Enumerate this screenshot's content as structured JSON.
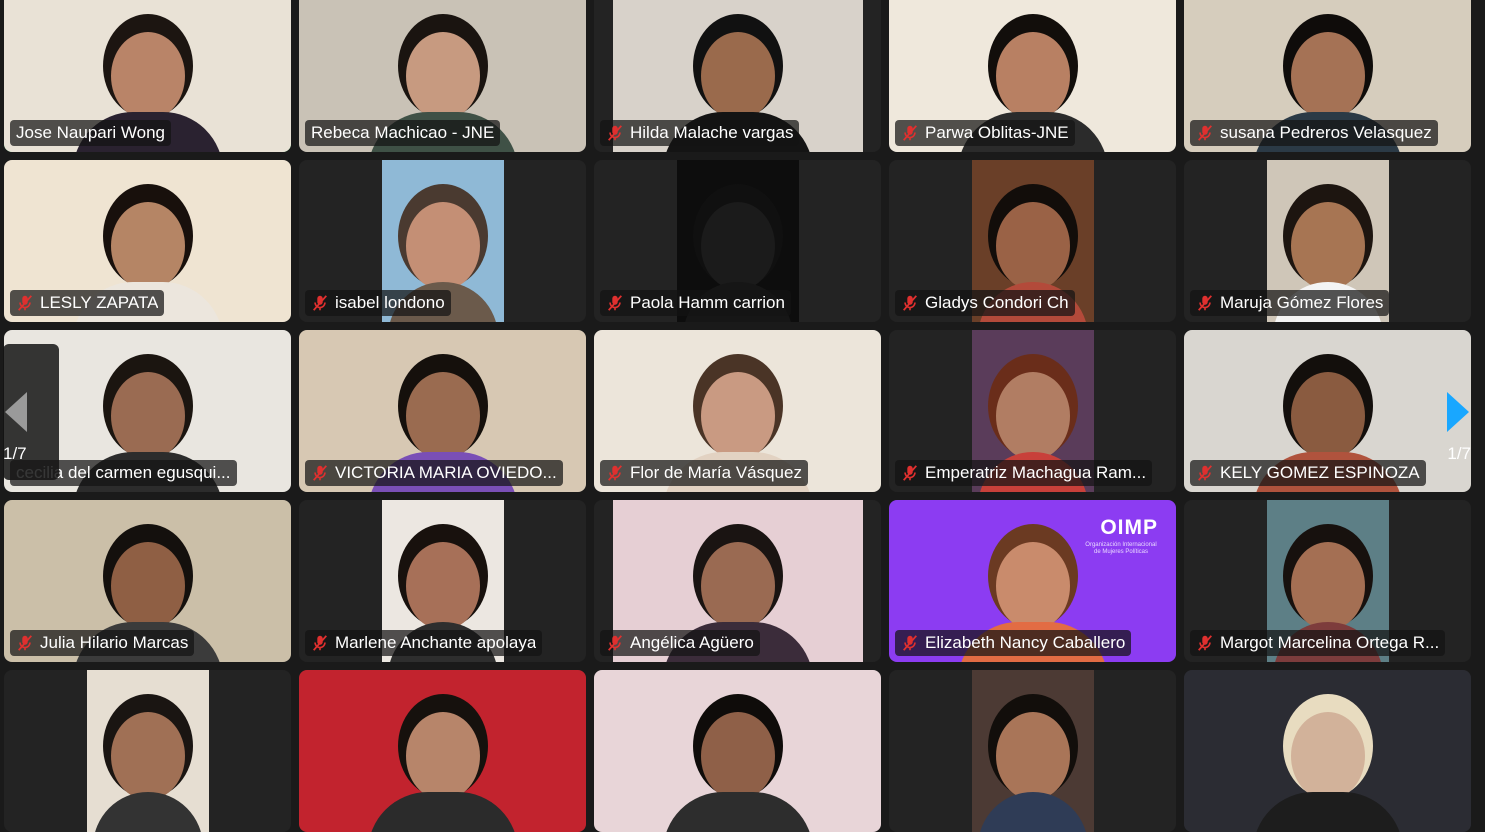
{
  "colors": {
    "active_speaker_border": "#23d160",
    "mute_icon": "#e0302f",
    "nav_arrow_active": "#19a7ff",
    "nav_arrow_inactive": "#9a9a9a",
    "oimp_background": "#8c3cf2"
  },
  "pagination": {
    "left_page": "1/7",
    "right_page": "1/7"
  },
  "oimp": {
    "logo": "OIMP",
    "subtitle": "Organización Internacional de Mujeres Políticas"
  },
  "participants": [
    {
      "name": "Jose Naupari Wong",
      "muted": false,
      "active": true
    },
    {
      "name": "Rebeca Machicao - JNE",
      "muted": false,
      "active": false
    },
    {
      "name": "Hilda Malache vargas",
      "muted": true,
      "active": false
    },
    {
      "name": "Parwa Oblitas-JNE",
      "muted": true,
      "active": false
    },
    {
      "name": "susana Pedreros Velasquez",
      "muted": true,
      "active": false
    },
    {
      "name": "LESLY ZAPATA",
      "muted": true,
      "active": false
    },
    {
      "name": "isabel londono",
      "muted": true,
      "active": false
    },
    {
      "name": "Paola Hamm carrion",
      "muted": true,
      "active": false
    },
    {
      "name": "Gladys Condori Ch",
      "muted": true,
      "active": false
    },
    {
      "name": "Maruja Gómez Flores",
      "muted": true,
      "active": false
    },
    {
      "name": "cecilia del carmen egusqui...",
      "muted": false,
      "active": false
    },
    {
      "name": "VICTORIA MARIA OVIEDO...",
      "muted": true,
      "active": false
    },
    {
      "name": "Flor de María Vásquez",
      "muted": true,
      "active": false
    },
    {
      "name": "Emperatriz Machagua Ram...",
      "muted": true,
      "active": false
    },
    {
      "name": "KELY GOMEZ ESPINOZA",
      "muted": true,
      "active": false
    },
    {
      "name": "Julia Hilario Marcas",
      "muted": true,
      "active": false
    },
    {
      "name": "Marlene Anchante apolaya",
      "muted": true,
      "active": false
    },
    {
      "name": "Angélica Agüero",
      "muted": true,
      "active": false
    },
    {
      "name": "Elizabeth Nancy Caballero",
      "muted": true,
      "active": false
    },
    {
      "name": "Margot Marcelina Ortega R...",
      "muted": true,
      "active": false
    },
    {
      "name": "",
      "muted": false,
      "active": false
    },
    {
      "name": "",
      "muted": false,
      "active": false
    },
    {
      "name": "",
      "muted": false,
      "active": false
    },
    {
      "name": "",
      "muted": false,
      "active": false
    },
    {
      "name": "",
      "muted": false,
      "active": false
    }
  ]
}
